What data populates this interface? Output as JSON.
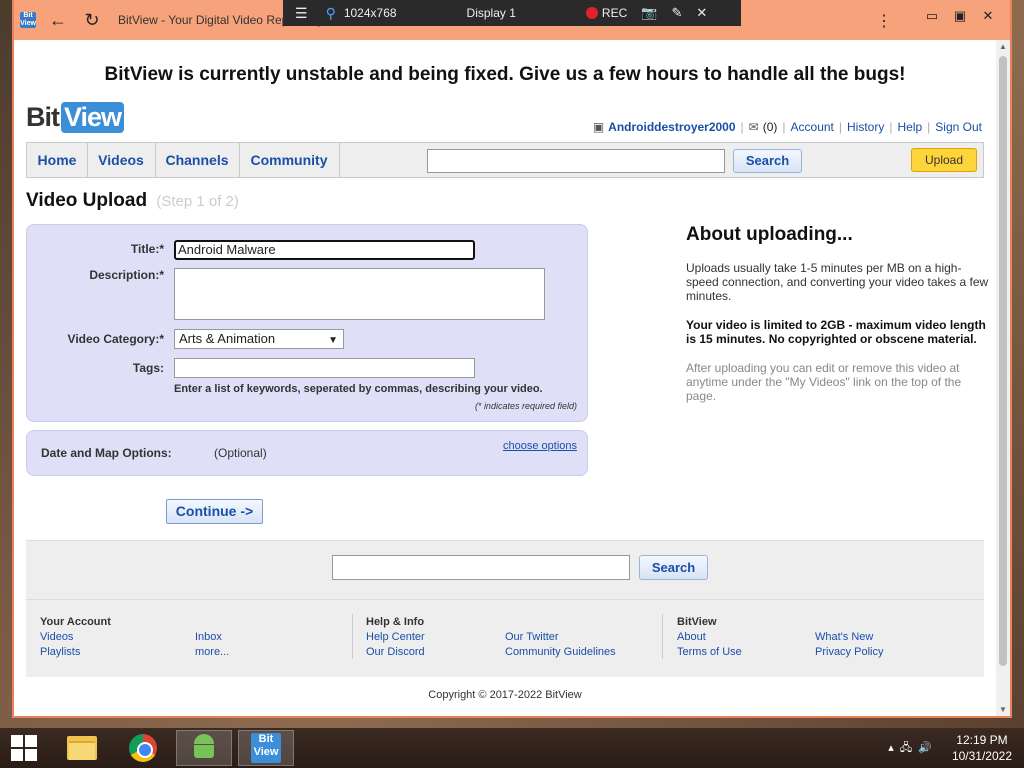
{
  "remote": {
    "resolution": "1024x768",
    "display": "Display 1",
    "rec": "REC"
  },
  "browser": {
    "tab_title": "BitView - Your Digital Video Repository"
  },
  "site": {
    "banner": "BitView is currently unstable and being fixed. Give us a few hours to handle all the bugs!",
    "logo_bit": "Bit",
    "logo_view": "View",
    "user": {
      "username": "Androiddestroyer2000",
      "inbox_count": "(0)",
      "links": [
        "Account",
        "History",
        "Help",
        "Sign Out"
      ]
    },
    "nav": {
      "items": [
        "Home",
        "Videos",
        "Channels",
        "Community"
      ],
      "search_label": "Search",
      "upload_label": "Upload"
    }
  },
  "upload": {
    "heading": "Video Upload",
    "step": "(Step 1 of 2)",
    "title_label": "Title:*",
    "title_value": "Android Malware",
    "description_label": "Description:*",
    "description_value": "",
    "category_label": "Video Category:*",
    "category_value": "Arts & Animation",
    "tags_label": "Tags:",
    "tags_value": "",
    "tags_hint": "Enter a list of keywords, seperated by commas, describing your video.",
    "required_note": "(* indicates required field)",
    "options_label": "Date and Map Options:",
    "options_optional": "(Optional)",
    "options_link": "choose options",
    "continue_label": "Continue ->"
  },
  "about": {
    "heading": "About uploading...",
    "p1": "Uploads usually take 1-5 minutes per MB on a high-speed connection, and converting your video takes a few minutes.",
    "p2": "Your video is limited to 2GB - maximum video length is 15 minutes. No copyrighted or obscene material.",
    "p3": "After uploading you can edit or remove this video at anytime under the \"My Videos\" link on the top of the page."
  },
  "footer": {
    "search_label": "Search",
    "col1_heading": "Your Account",
    "col1_links_a": [
      "Videos",
      "Playlists"
    ],
    "col1_links_b": [
      "Inbox",
      "more..."
    ],
    "col2_heading": "Help & Info",
    "col2_links_a": [
      "Help Center",
      "Our Discord"
    ],
    "col2_links_b": [
      "Our Twitter",
      "Community Guidelines"
    ],
    "col3_heading": "BitView",
    "col3_links_a": [
      "About",
      "Terms of Use"
    ],
    "col3_links_b": [
      "What's New",
      "Privacy Policy"
    ],
    "copyright": "Copyright © 2017-2022 BitView"
  },
  "taskbar": {
    "time": "12:19 PM",
    "date": "10/31/2022",
    "bitview_icon_text": "Bit View"
  }
}
